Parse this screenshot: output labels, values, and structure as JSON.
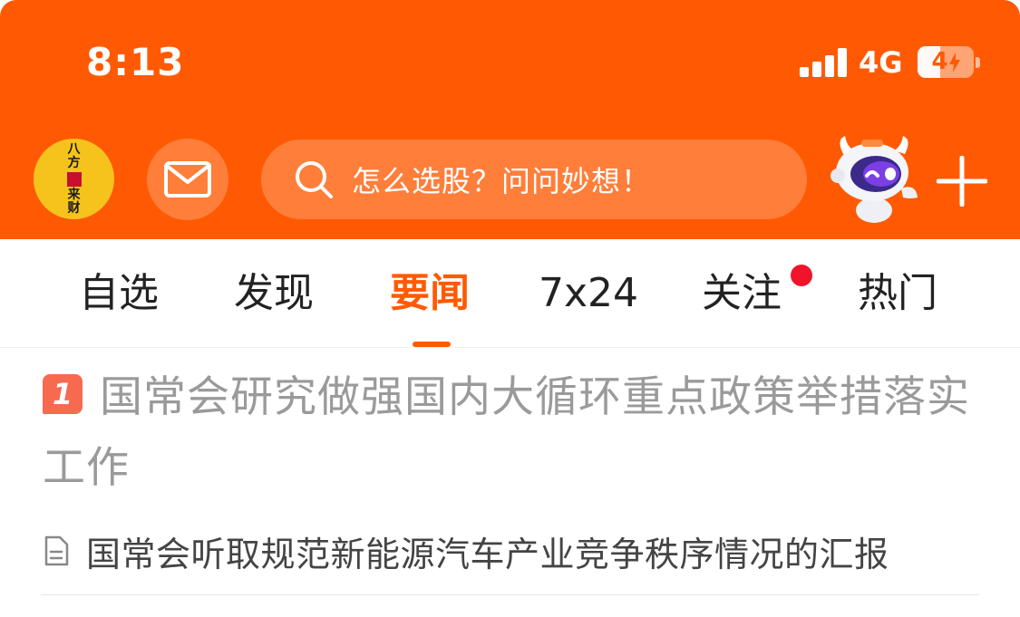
{
  "colors": {
    "brand_orange": "#ff5a03",
    "header_bg": "#ff5a03",
    "notification_dot": "#f0142a",
    "rank_badge": "#f66a50",
    "headline_text": "#9a9a9a"
  },
  "status_bar": {
    "time": "8:13",
    "network": "4G",
    "battery_label": "4",
    "battery_level": 0.4,
    "charging": true,
    "signal_bars": 4
  },
  "header": {
    "avatar_text": [
      "八",
      "方",
      "来",
      "财"
    ],
    "mail_icon": "mail-icon",
    "search_icon": "search-icon",
    "search_placeholder": "怎么选股？问问妙想！",
    "assistant_icon": "robot-assistant-icon",
    "add_icon": "plus-icon"
  },
  "tabs": [
    {
      "label": "自选",
      "active": false
    },
    {
      "label": "发现",
      "active": false
    },
    {
      "label": "要闻",
      "active": true
    },
    {
      "label": "7x24",
      "active": false
    },
    {
      "label": "关注",
      "active": false,
      "badge_dot": true
    },
    {
      "label": "热门",
      "active": false
    }
  ],
  "news": {
    "items": [
      {
        "rank": "1",
        "headline": "国常会研究做强国内大循环重点政策举措落实工作",
        "related": [
          {
            "icon": "document-icon",
            "title": "国常会听取规范新能源汽车产业竞争秩序情况的汇报"
          }
        ]
      }
    ]
  }
}
